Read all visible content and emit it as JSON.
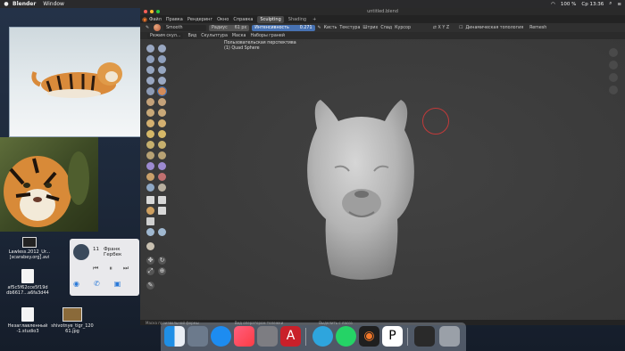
{
  "menubar": {
    "app_name": "Blender",
    "items": [
      "Window"
    ],
    "clock": "Ср 13:36",
    "battery": "100 %"
  },
  "desktop_icons": [
    {
      "name": "Lawless.2012_Ur... [scarabey.org].avi",
      "kind": "video"
    },
    {
      "name": "af5c5f62cce5f19d db6617...a6fa3d44",
      "kind": "doc"
    },
    {
      "name": "Незаглавленный -1.studio3",
      "kind": "doc"
    },
    {
      "name": "shivotnye_tigr_120 61.jpg",
      "kind": "image"
    }
  ],
  "music": {
    "track_number": "11",
    "track_title": "Франк Гербек"
  },
  "blender": {
    "window_title": "untitled.blend",
    "top_menu": [
      "Файл",
      "Правка",
      "Рендеринг",
      "Окно",
      "Справка"
    ],
    "workspaces": [
      "Sculpting",
      "Shading"
    ],
    "active_workspace": "Sculpting",
    "tool_header": {
      "brush_name": "Smooth",
      "radius_label": "Радиус",
      "radius_value": "61 px",
      "strength_label": "Интенсивность",
      "strength_value": "0.271",
      "menus": [
        "Кисть",
        "Текстура",
        "Штрих",
        "Спад",
        "Курсор"
      ],
      "orientation_label": "Динамическая топология",
      "extra_label": "Remesh"
    },
    "header2": [
      "Режим скул...",
      "Вид",
      "Скульптура",
      "Маска",
      "Наборы граней"
    ],
    "viewport": {
      "view_name": "Пользовательская перспектива",
      "object_name": "(1) Quad Sphere"
    },
    "statusbar": [
      "Маска произвольной формы",
      "Вид оператором тележки",
      "Выделить с лассо"
    ]
  },
  "colors": {
    "accent_blue": "#4772b3",
    "brush_circle": "#c23a3a",
    "blender_orange": "#f5792a"
  }
}
